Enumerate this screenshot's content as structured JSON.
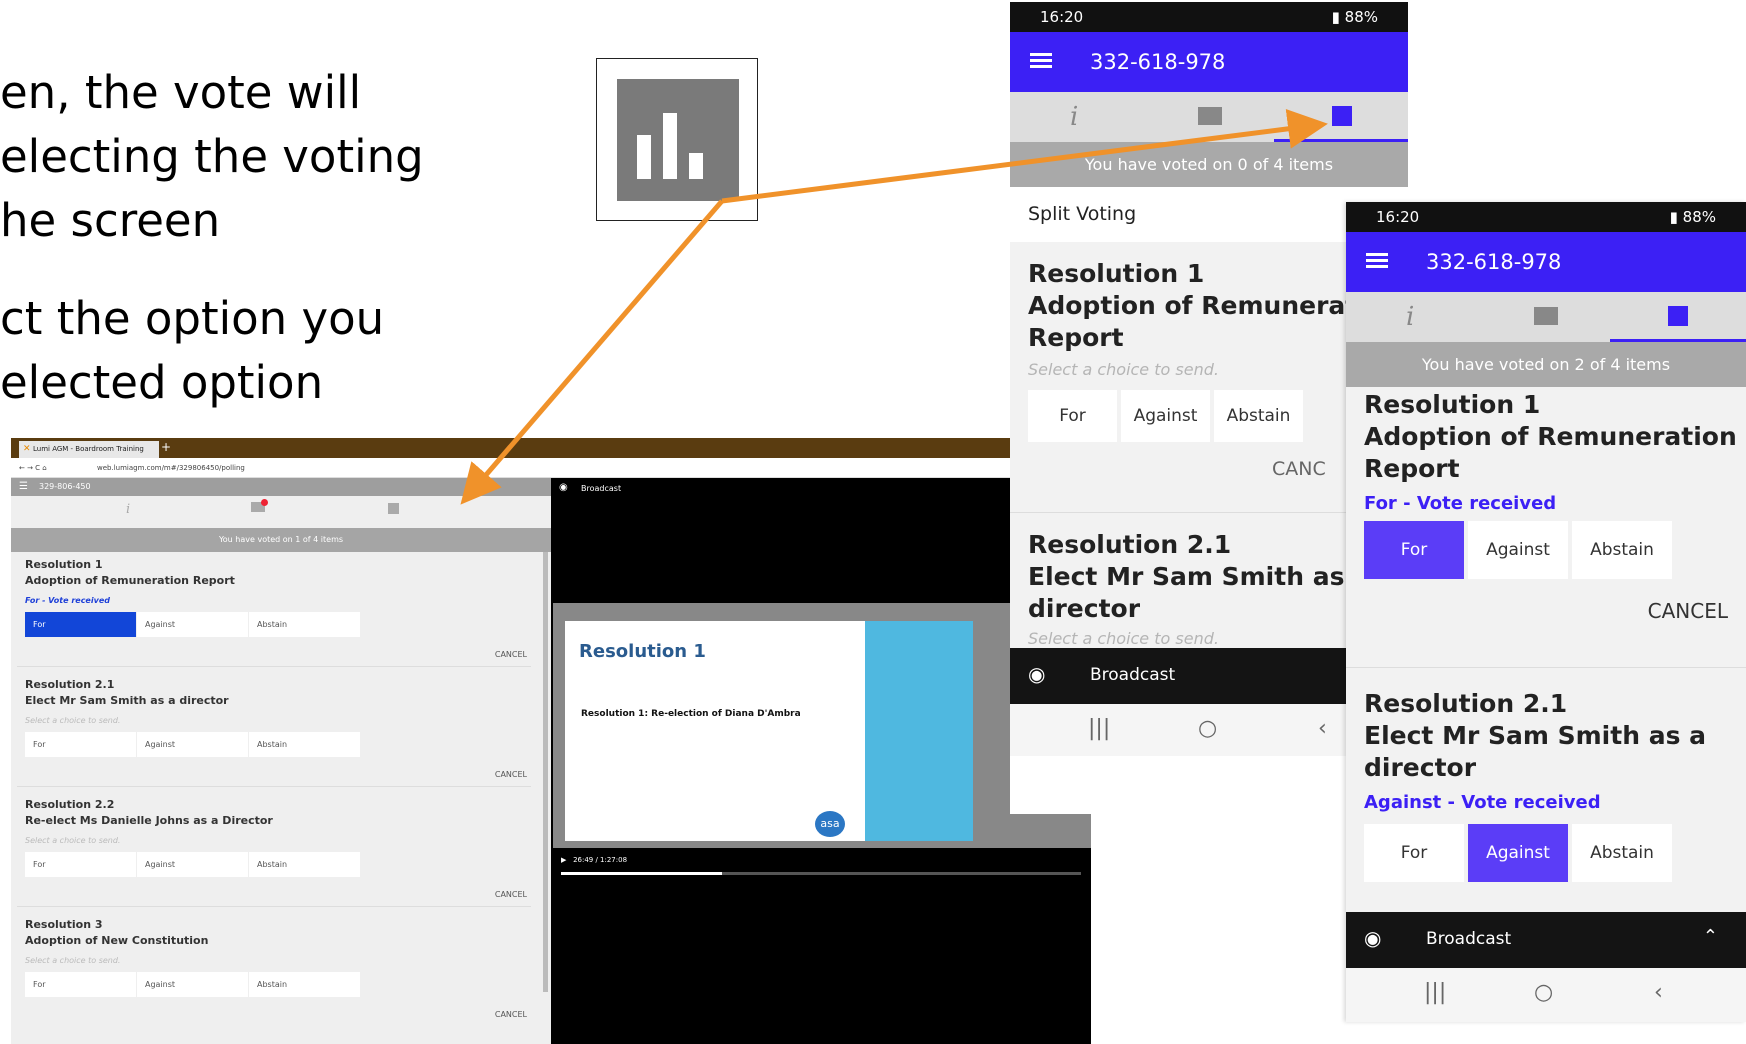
{
  "slide": {
    "lines": [
      "en, the vote will",
      "electing the voting",
      "he screen",
      "ct the option you",
      "elected option"
    ]
  },
  "browser": {
    "tab_title": "Lumi AGM - Boardroom Training",
    "url": "web.lumiagm.com/m#/329806450/polling",
    "meeting_id": "329-806-450",
    "voted_text": "You have voted on 1 of 4 items",
    "resolutions": [
      {
        "title": "Resolution 1",
        "subtitle": "Adoption of Remuneration Report",
        "status": "For - Vote received",
        "selected": "For"
      },
      {
        "title": "Resolution 2.1",
        "subtitle": "Elect Mr Sam Smith as a director",
        "status": "Select a choice to send.",
        "selected": ""
      },
      {
        "title": "Resolution 2.2",
        "subtitle": "Re-elect Ms Danielle Johns as a Director",
        "status": "Select a choice to send.",
        "selected": ""
      },
      {
        "title": "Resolution 3",
        "subtitle": "Adoption of New Constitution",
        "status": "Select a choice to send.",
        "selected": ""
      }
    ],
    "options": [
      "For",
      "Against",
      "Abstain"
    ],
    "cancel": "CANCEL",
    "broadcast": "Broadcast",
    "video": {
      "slide_title": "Resolution 1",
      "slide_bullet": "Resolution 1: Re-election of Diana D'Ambra",
      "time": "26:49 / 1:27:08",
      "logo": "asa",
      "progress": 0.31
    }
  },
  "phone1": {
    "time": "16:20",
    "battery": "88%",
    "meeting_id": "332-618-978",
    "voted_text": "You have voted on 0 of 4 items",
    "section": "Split Voting",
    "res1": {
      "title": "Resolution 1",
      "sub1": "Adoption of Remuneration",
      "sub2": "Report",
      "status": "Select a choice to send."
    },
    "res2": {
      "title": "Resolution 2.1",
      "sub1": "Elect Mr Sam Smith as a",
      "sub2": "director",
      "status": "Select a choice to send."
    },
    "options": [
      "For",
      "Against",
      "Abstain"
    ],
    "cancel": "CANC",
    "broadcast": "Broadcast"
  },
  "phone2": {
    "time": "16:20",
    "battery": "88%",
    "meeting_id": "332-618-978",
    "voted_text": "You have voted on 2 of 4 items",
    "res1": {
      "title": "Resolution 1",
      "sub1": "Adoption of Remuneration",
      "sub2": "Report",
      "status": "For - Vote received"
    },
    "res2": {
      "title": "Resolution 2.1",
      "sub1": "Elect Mr Sam Smith as a",
      "sub2": "director",
      "status": "Against - Vote received"
    },
    "options": [
      "For",
      "Against",
      "Abstain"
    ],
    "cancel": "CANCEL",
    "broadcast": "Broadcast"
  },
  "colors": {
    "accent": "#3c20f5",
    "selected_web": "#1246d8",
    "arrow": "#f0922a"
  }
}
